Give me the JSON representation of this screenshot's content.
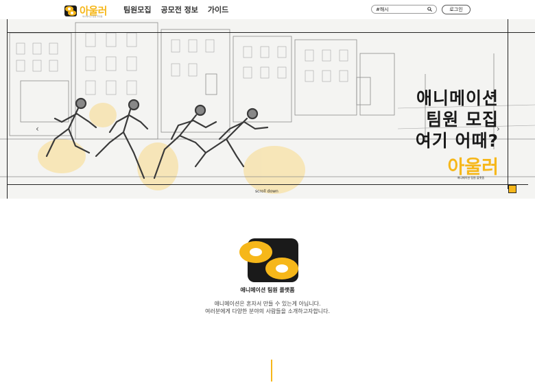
{
  "header": {
    "logo_text": "아울러",
    "logo_subtitle": "애니메이션 팀원 플랫폼",
    "nav": [
      "팀원모집",
      "공모전 정보",
      "가이드"
    ],
    "search_value": "#해시",
    "login_label": "로그인"
  },
  "hero": {
    "headline": [
      "애니메이션",
      "팀원 모집",
      "여기 어때?"
    ],
    "brand": "아울러",
    "tagline": "애니메이션 팀원 플랫폼",
    "scroll_label": "scroll down"
  },
  "intro": {
    "title": "애니메이션 팀원 플랫폼",
    "desc_line1": "애니메이션은 혼자서 만들 수 있는게 아닙니다.",
    "desc_line2": "여러분에게 다양한 분야의 사람들을 소개하고자합니다."
  },
  "colors": {
    "accent": "#f6b71a",
    "ink": "#1a1a1a"
  },
  "icons": [
    "logo-mark-icon",
    "search-icon",
    "chevron-left-icon",
    "chevron-right-icon"
  ]
}
